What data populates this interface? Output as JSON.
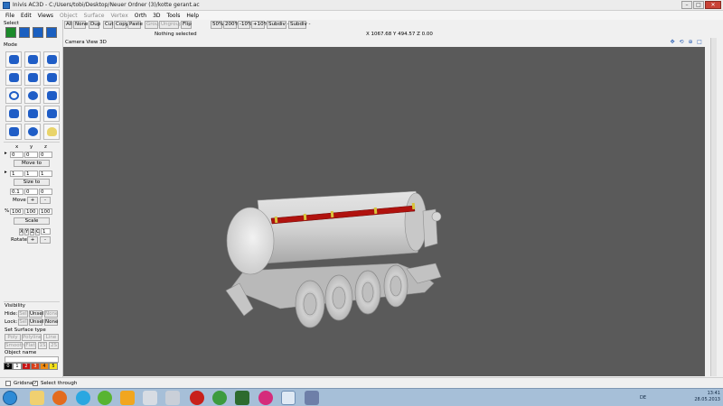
{
  "window": {
    "title": "Inivis AC3D - C:/Users/tobi/Desktop/Neuer Ordner (3)/kotte gerant.ac"
  },
  "menu": [
    "File",
    "Edit",
    "Views",
    "Object",
    "Surface",
    "Vertex",
    "Orth",
    "3D",
    "Tools",
    "Help"
  ],
  "left_panel": {
    "select_label": "Select",
    "mode_label": "Mode",
    "xyz_labels": [
      "x",
      "y",
      "z"
    ],
    "move_values": [
      "0",
      "0",
      "0"
    ],
    "move_to_label": "Move to",
    "size_values": [
      "1",
      "1",
      "1"
    ],
    "size_to_label": "Size to",
    "move_step_values": [
      "0.1",
      "0",
      "0"
    ],
    "move_label": "Move",
    "plus": "+",
    "minus": "-",
    "percent_sign": "%",
    "scale_values": [
      "100",
      "100",
      "100"
    ],
    "scale_label": "Scale",
    "rotate_axes": [
      "X",
      "Y",
      "Z",
      "C"
    ],
    "rotate_value": "1",
    "rotate_label": "Rotate",
    "visibility_label": "Visibility",
    "hide_label": "Hide:",
    "lock_label": "Lock:",
    "sel_label": "Sel",
    "unsel_label": "Unsel",
    "none_label": "None",
    "surface_type_label": "Set Surface type",
    "surface_row1": [
      "Poly",
      "Polyline",
      "Line"
    ],
    "surface_row2": [
      "Smooth",
      "Flat",
      "1S",
      "2S"
    ],
    "object_name_label": "Object name",
    "palette": [
      "0",
      "1",
      "2",
      "3",
      "4",
      "5"
    ]
  },
  "toolbar": {
    "buttons": [
      "All",
      "None",
      "Dup",
      "Cut",
      "Copy",
      "Paste",
      "Group",
      "Ungroup",
      "Flip",
      "50%",
      "200%",
      "-10%",
      "+10%",
      "Subdiv +",
      "Subdiv -"
    ],
    "status_left": "Nothing selected",
    "status_coords": "X 1067.68 Y 494.57 Z 0.00"
  },
  "view": {
    "title": "Camera View 3D"
  },
  "bottom": {
    "gridsnap_label": "Gridsnap",
    "select_through_label": "Select through"
  },
  "taskbar": {
    "lang": "DE",
    "time": "13:41",
    "date": "28.05.2013"
  },
  "colors": {
    "viewport_bg": "#5a5a5a",
    "tank_stripe": "#b0120e",
    "marker": "#d8c43a",
    "tool_blue": "#1f5dc6"
  }
}
